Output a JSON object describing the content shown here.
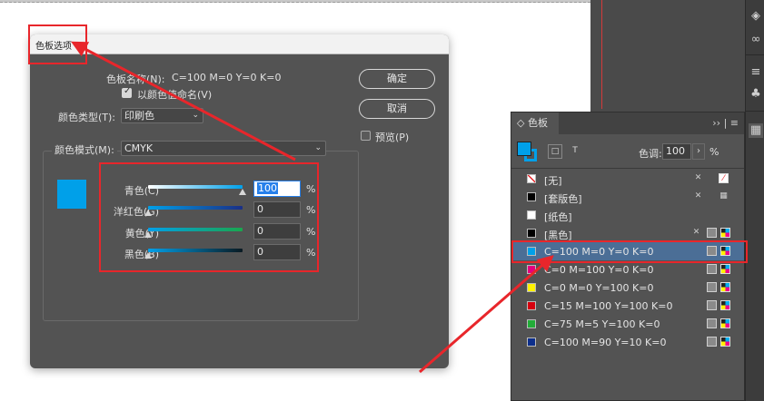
{
  "dialog": {
    "title": "色板选项",
    "swatch_name_label": "色板名称(N):",
    "swatch_name_value": "C=100 M=0 Y=0 K=0",
    "name_with_value_label": "以颜色值命名(V)",
    "color_type_label": "颜色类型(T):",
    "color_type_value": "印刷色",
    "color_mode_label": "颜色模式(M):",
    "color_mode_value": "CMYK",
    "ok_label": "确定",
    "cancel_label": "取消",
    "preview_label": "预览(P)",
    "preview_color": "#00a0e9",
    "sliders": [
      {
        "label": "青色(C)",
        "value": "100",
        "unit": "%",
        "level": 1.0
      },
      {
        "label": "洋红色(G)",
        "value": "0",
        "unit": "%",
        "level": 0.0
      },
      {
        "label": "黄色(Y)",
        "value": "0",
        "unit": "%",
        "level": 0.0
      },
      {
        "label": "黑色(B)",
        "value": "0",
        "unit": "%",
        "level": 0.0
      }
    ]
  },
  "panel": {
    "tab_label": "色板",
    "tab_extra": "›› | ≡",
    "tint_label": "色调:",
    "tint_value": "100",
    "tint_unit": "%",
    "swatches": [
      {
        "name": "[无]",
        "color": "none"
      },
      {
        "name": "[套版色]",
        "color": "#000000"
      },
      {
        "name": "[纸色]",
        "color": "#ffffff"
      },
      {
        "name": "[黑色]",
        "color": "#000000"
      },
      {
        "name": "C=100 M=0 Y=0 K=0",
        "color": "#00a0e9"
      },
      {
        "name": "C=0 M=100 Y=0 K=0",
        "color": "#e4007f"
      },
      {
        "name": "C=0 M=0 Y=100 K=0",
        "color": "#fff100"
      },
      {
        "name": "C=15 M=100 Y=100 K=0",
        "color": "#d7000f"
      },
      {
        "name": "C=75 M=5 Y=100 K=0",
        "color": "#22ac38"
      },
      {
        "name": "C=100 M=90 Y=10 K=0",
        "color": "#0d2f8c"
      }
    ]
  },
  "colors": {
    "annotation_red": "#e8262b",
    "selected_row": "#4b6e96"
  }
}
